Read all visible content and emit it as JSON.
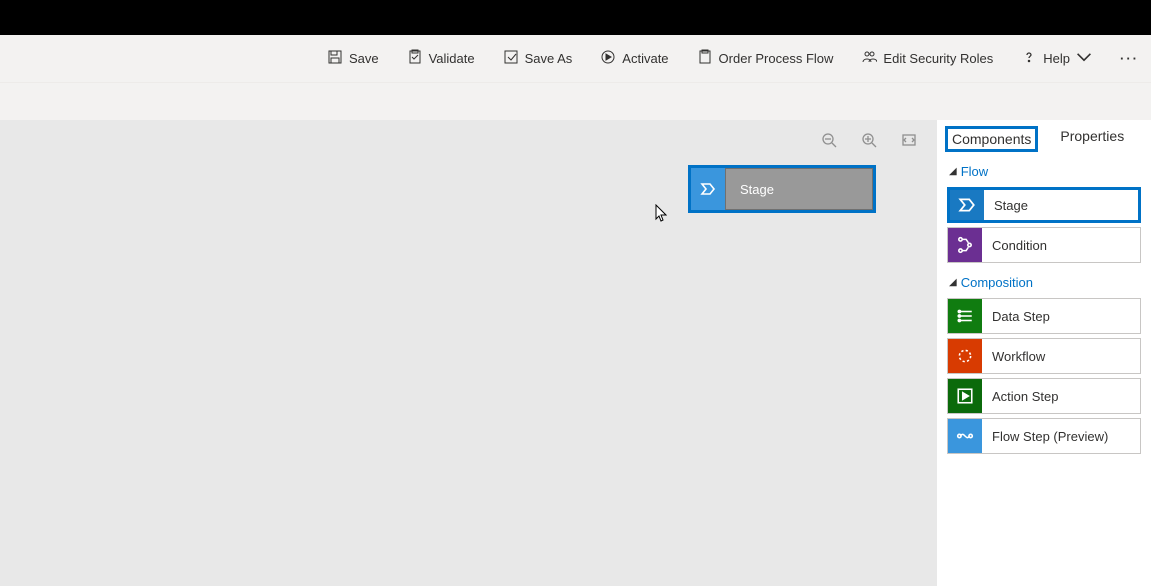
{
  "toolbar": {
    "save": "Save",
    "validate": "Validate",
    "save_as": "Save As",
    "activate": "Activate",
    "process": "Order Process Flow",
    "edit_roles": "Edit Security Roles",
    "help": "Help"
  },
  "dragged": {
    "label": "Stage"
  },
  "tabs": {
    "components": "Components",
    "properties": "Properties",
    "active": "components"
  },
  "sections": {
    "flow": "Flow",
    "composition": "Composition"
  },
  "palette": {
    "flow": [
      {
        "label": "Stage",
        "color": "bg-blue",
        "name": "palette-item-stage",
        "highlight": true
      },
      {
        "label": "Condition",
        "color": "bg-purple",
        "name": "palette-item-condition",
        "highlight": false
      }
    ],
    "composition": [
      {
        "label": "Data Step",
        "color": "bg-green",
        "name": "palette-item-data-step"
      },
      {
        "label": "Workflow",
        "color": "bg-orange",
        "name": "palette-item-workflow"
      },
      {
        "label": "Action Step",
        "color": "bg-green2",
        "name": "palette-item-action-step"
      },
      {
        "label": "Flow Step (Preview)",
        "color": "bg-azure",
        "name": "palette-item-flow-step"
      }
    ]
  }
}
